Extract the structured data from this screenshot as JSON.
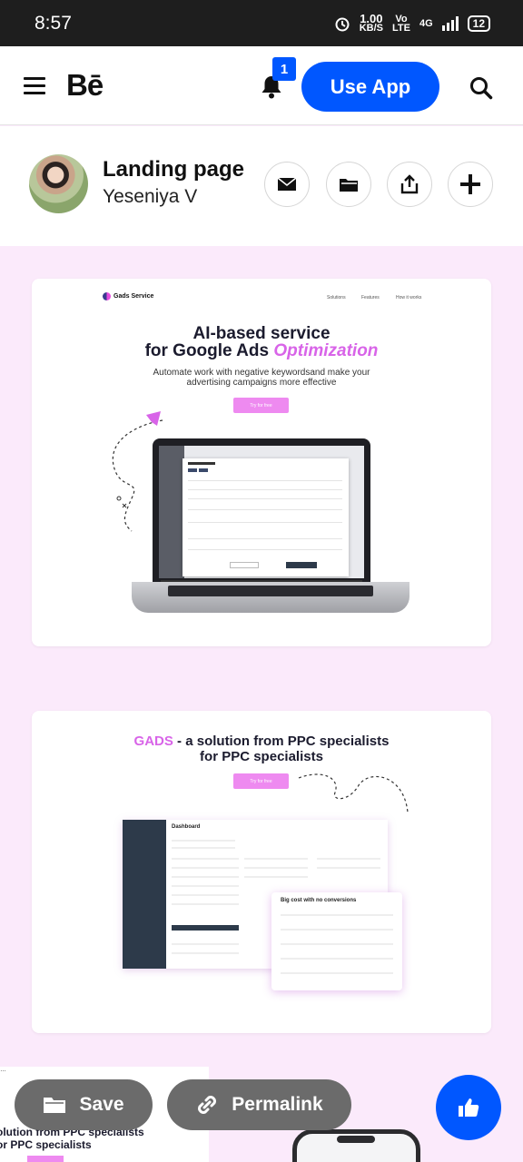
{
  "status_bar": {
    "time": "8:57",
    "speed_value": "1.00",
    "speed_unit": "KB/S",
    "volte_top": "Vo",
    "volte_bottom": "LTE",
    "network": "4G",
    "battery": "12"
  },
  "nav": {
    "logo": "Bē",
    "notification_count": "1",
    "use_app_label": "Use App"
  },
  "project": {
    "title": "Landing page",
    "author": "Yeseniya V"
  },
  "card1": {
    "logo_text": "Gads Service",
    "nav_items": [
      "Solutions",
      "Features",
      "How it works"
    ],
    "hero_line1": "AI-based service",
    "hero_line2_plain": "for Google Ads ",
    "hero_line2_accent": "Optimization",
    "sub_line1": "Automate work with negative keywordsand make your",
    "sub_line2": "advertising campaigns more effective",
    "cta": "Try for free"
  },
  "card2": {
    "title_accent": "GADS",
    "title_line1": " - a solution from PPC specialists",
    "title_line2": "for PPC specialists",
    "cta": "Try for free",
    "dashboard_title": "Dashboard",
    "popup_title": "Big cost with no conversions"
  },
  "partial": {
    "line1": "olution from PPC specialists",
    "line2": "or PPC specialists"
  },
  "actions": {
    "save_label": "Save",
    "permalink_label": "Permalink"
  },
  "colors": {
    "behance_blue": "#0057ff",
    "page_bg": "#fbeafb",
    "accent_pink": "#d864e8",
    "pill_gray": "#6b6b6b"
  }
}
